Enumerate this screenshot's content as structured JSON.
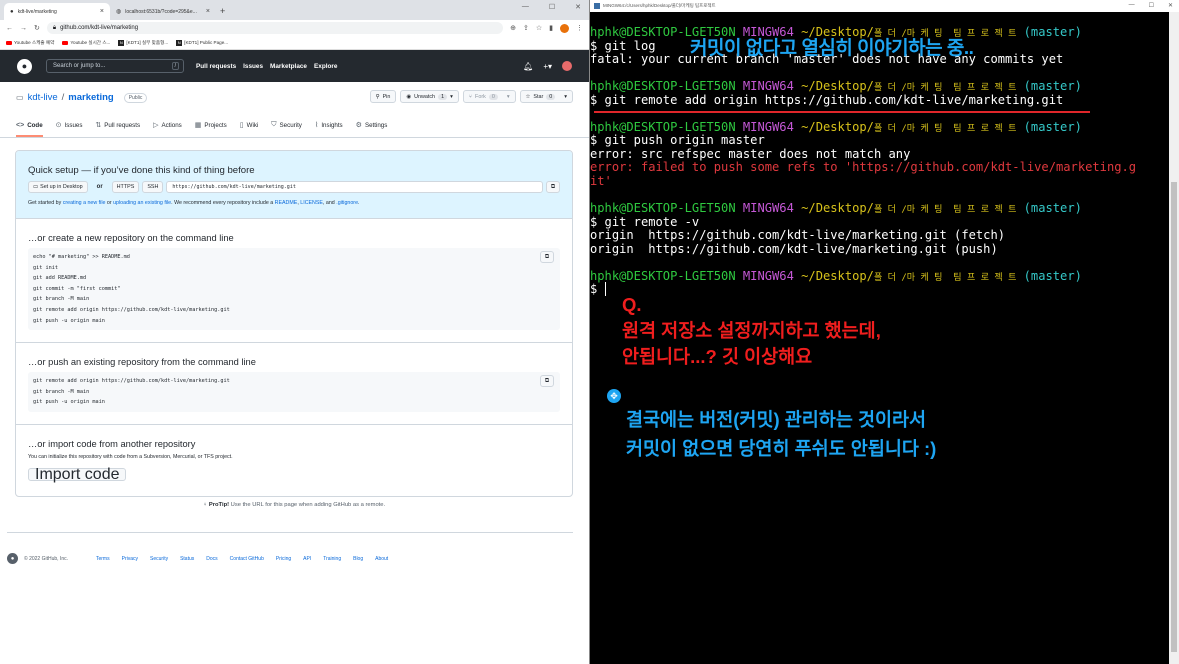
{
  "browser": {
    "tabs": [
      {
        "label": "kdt-live/marketing",
        "active": true
      },
      {
        "label": "localhost:6531b/?code=295&e...",
        "active": false
      }
    ],
    "url": "github.com/kdt-live/marketing",
    "bookmarks": [
      "Youtube 스케줄 예약",
      "Youtube 실시간 스...",
      "[KDT1] 실무 맞춤형...",
      "[KDT1] Public Page..."
    ]
  },
  "github": {
    "search_placeholder": "Search or jump to...",
    "search_key": "/",
    "nav": [
      "Pull requests",
      "Issues",
      "Marketplace",
      "Explore"
    ],
    "owner": "kdt-live",
    "repo": "marketing",
    "visibility": "Public",
    "actions": {
      "pin": "Pin",
      "unwatch": "Unwatch",
      "unwatch_count": "1",
      "fork": "Fork",
      "fork_count": "0",
      "star": "Star",
      "star_count": "0"
    },
    "tabs": [
      {
        "label": "Code",
        "icon": "code-icon"
      },
      {
        "label": "Issues",
        "icon": "issue-icon"
      },
      {
        "label": "Pull requests",
        "icon": "pull-request-icon"
      },
      {
        "label": "Actions",
        "icon": "play-icon"
      },
      {
        "label": "Projects",
        "icon": "table-icon"
      },
      {
        "label": "Wiki",
        "icon": "book-icon"
      },
      {
        "label": "Security",
        "icon": "shield-icon"
      },
      {
        "label": "Insights",
        "icon": "graph-icon"
      },
      {
        "label": "Settings",
        "icon": "gear-icon"
      }
    ],
    "quick_setup": {
      "title": "Quick setup — if you’ve done this kind of thing before",
      "desktop_btn": "Set up in Desktop",
      "or": "or",
      "https": "HTTPS",
      "ssh": "SSH",
      "clone_url": "https://github.com/kdt-live/marketing.git",
      "help_1": "Get started by ",
      "help_link1": "creating a new file",
      "help_2": " or ",
      "help_link2": "uploading an existing file",
      "help_3": ". We recommend every repository include a ",
      "help_link3": "README",
      "help_4": ", ",
      "help_link4": "LICENSE",
      "help_5": ", and ",
      "help_link5": ".gitignore",
      "help_6": "."
    },
    "create_section": {
      "title": "…or create a new repository on the command line",
      "code": "echo \"# marketing\" >> README.md\ngit init\ngit add README.md\ngit commit -m \"first commit\"\ngit branch -M main\ngit remote add origin https://github.com/kdt-live/marketing.git\ngit push -u origin main"
    },
    "push_section": {
      "title": "…or push an existing repository from the command line",
      "code": "git remote add origin https://github.com/kdt-live/marketing.git\ngit branch -M main\ngit push -u origin main"
    },
    "import_section": {
      "title": "…or import code from another repository",
      "desc": "You can initialize this repository with code from a Subversion, Mercurial, or TFS project.",
      "button": "Import code"
    },
    "protip_label": "ProTip!",
    "protip_text": " Use the URL for this page when adding GitHub as a remote.",
    "footer": {
      "copyright": "© 2022 GitHub, Inc.",
      "links": [
        "Terms",
        "Privacy",
        "Security",
        "Status",
        "Docs",
        "Contact GitHub",
        "Pricing",
        "API",
        "Training",
        "Blog",
        "About"
      ]
    }
  },
  "terminal": {
    "title": "MINGW64:/c/Users/hphk/Desktop/풀더/마케팅 팀프로젝트",
    "prompt_user": "hphk@DESKTOP-LGET50N",
    "prompt_shell": "MINGW64",
    "prompt_path": "~/Desktop/",
    "prompt_path_kr": "폴 더 /마 케 팅  팀 프 로 젝 트",
    "prompt_branch": "(master)",
    "cmd_log": "$ git log",
    "out_log": "fatal: your current branch 'master' does not have any commits yet",
    "cmd_remote_add": "$ git remote add origin https://github.com/kdt-live/marketing.git",
    "cmd_push": "$ git push origin master",
    "out_push1": "error: src refspec master does not match any",
    "out_push2a": "error: failed to push some refs to 'https://github.com/kdt-live/marketing.g",
    "out_push2b": "it'",
    "cmd_remote_v": "$ git remote -v",
    "out_fetch": "origin  https://github.com/kdt-live/marketing.git (fetch)",
    "out_push": "origin  https://github.com/kdt-live/marketing.git (push)",
    "cursor_line": "$ "
  },
  "annotations": {
    "top": "커밋이 없다고 열심히 이야기하는 중..",
    "q_label": "Q.",
    "q_line1": "원격 저장소 설정까지하고 했는데,",
    "q_line2": "안됩니다...? 깃 이상해요",
    "a_line1": "결국에는 버전(커밋) 관리하는 것이라서",
    "a_line2": "커밋이 없으면 당연히 푸쉬도 안됩니다 :)",
    "colors": {
      "question": "#f01e1e",
      "answer": "#1ea5f2",
      "underline": "#e0262a"
    }
  }
}
